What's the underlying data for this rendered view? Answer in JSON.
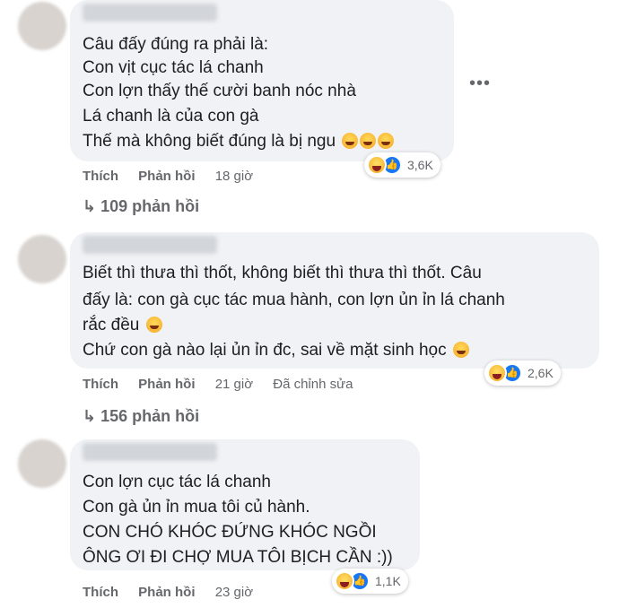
{
  "comments": [
    {
      "lines": [
        "Câu đấy đúng ra phải là:",
        "Con vịt cục tác lá chanh",
        "Con lợn thấy thế cười banh nóc nhà",
        "Lá chanh là của con gà",
        "Thế mà không biết đúng là bị ngu"
      ],
      "reaction_count": "3,6K",
      "like": "Thích",
      "reply": "Phản hồi",
      "time": "18 giờ",
      "edited": "",
      "view_replies": "109 phản hồi"
    },
    {
      "lines": [
        "Biết thì thưa thì thốt, không biết thì thưa thì thốt. Câu",
        "đấy là: con gà cục tác mua hành, con lợn ủn ỉn lá chanh",
        "rắc đều",
        "Chứ con gà nào lại ủn ỉn đc, sai về mặt sinh học"
      ],
      "reaction_count": "2,6K",
      "like": "Thích",
      "reply": "Phản hồi",
      "time": "21 giờ",
      "edited": "Đã chỉnh sửa",
      "view_replies": "156 phản hồi"
    },
    {
      "lines": [
        "Con lợn cục tác lá chanh",
        "Con gà ủn ỉn mua tôi củ hành.",
        "CON CHÓ KHÓC ĐỨNG KHÓC NGỒI",
        "ÔNG ƠI ĐI CHỢ MUA TÔI BỊCH CẦN :))"
      ],
      "reaction_count": "1,1K",
      "like": "Thích",
      "reply": "Phản hồi",
      "time": "23 giờ",
      "edited": "",
      "view_replies": ""
    }
  ],
  "more_icon": "•••",
  "reply_arrow": "↳"
}
